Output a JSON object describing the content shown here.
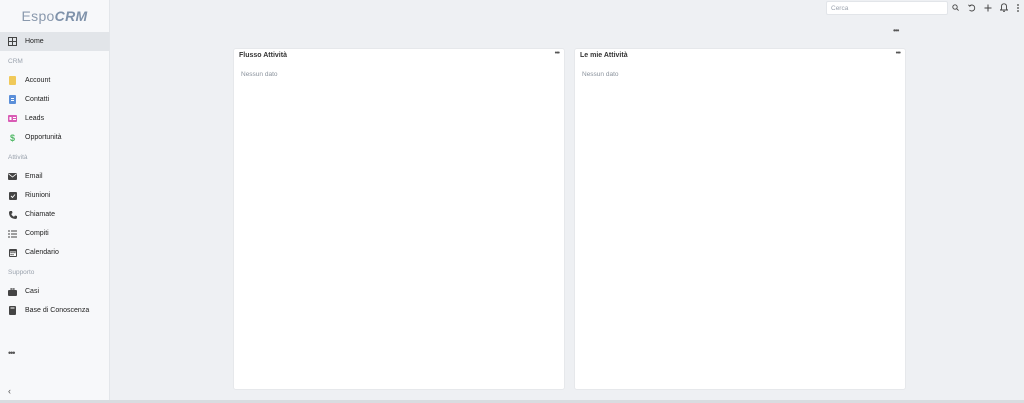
{
  "brand": {
    "logo_text": "Espo",
    "logo_crm": "CRM"
  },
  "sidebar": {
    "home": {
      "label": "Home",
      "icon": "grid-icon"
    },
    "groups": [
      {
        "label": "CRM",
        "items": [
          {
            "label": "Account",
            "icon": "building-icon",
            "color": "#f0c95a"
          },
          {
            "label": "Contatti",
            "icon": "contact-card-icon",
            "color": "#5b8fd9"
          },
          {
            "label": "Leads",
            "icon": "id-card-icon",
            "color": "#d95bb5"
          },
          {
            "label": "Opportunità",
            "icon": "dollar-icon",
            "color": "#4fb865"
          }
        ]
      },
      {
        "label": "Attività",
        "items": [
          {
            "label": "Email",
            "icon": "envelope-icon"
          },
          {
            "label": "Riunioni",
            "icon": "calendar-check-icon"
          },
          {
            "label": "Chiamate",
            "icon": "phone-icon"
          },
          {
            "label": "Compiti",
            "icon": "tasks-icon"
          },
          {
            "label": "Calendario",
            "icon": "calendar-icon"
          }
        ]
      },
      {
        "label": "Supporto",
        "items": [
          {
            "label": "Casi",
            "icon": "briefcase-icon"
          },
          {
            "label": "Base di Conoscenza",
            "icon": "book-icon"
          }
        ]
      }
    ],
    "more": "•••",
    "collapse": "‹"
  },
  "topbar": {
    "search_placeholder": "Cerca"
  },
  "dashboard": {
    "menu": "•••",
    "dashlets": [
      {
        "title": "Flusso Attività",
        "empty": "Nessun dato",
        "menu": "•••"
      },
      {
        "title": "Le mie Attività",
        "empty": "Nessun dato",
        "menu": "•••"
      }
    ]
  }
}
